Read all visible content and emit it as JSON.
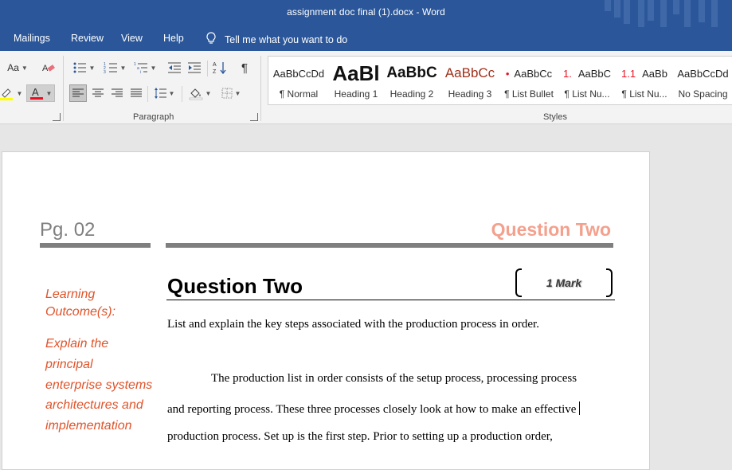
{
  "window": {
    "title": "assignment doc final (1).docx  -  Word"
  },
  "menu": {
    "tabs": [
      "Mailings",
      "Review",
      "View",
      "Help"
    ],
    "tell_me": "Tell me what you want to do"
  },
  "ribbon": {
    "font_group": {
      "change_case_label": "Aa"
    },
    "paragraph_group_label": "Paragraph",
    "styles_group_label": "Styles",
    "styles": [
      {
        "preview": "AaBbCcDd",
        "name": "¶ Normal"
      },
      {
        "preview": "AaBl",
        "name": "Heading 1"
      },
      {
        "preview": "AaBbC",
        "name": "Heading 2"
      },
      {
        "preview": "AaBbCc",
        "name": "Heading 3"
      },
      {
        "preview": "AaBbCc",
        "bullet": "•",
        "name": "¶ List Bullet"
      },
      {
        "preview": "AaBbC",
        "bullet": "1.",
        "name": "¶ List Nu..."
      },
      {
        "preview": "AaBb",
        "bullet": "1.1",
        "name": "¶ List Nu..."
      },
      {
        "preview": "AaBbCcDd",
        "name": "No Spacing"
      }
    ],
    "colors": {
      "highlight": "#ffff00",
      "font_color": "#e81123",
      "heading3": "#a0301a",
      "list_accent": "#e81123"
    }
  },
  "document": {
    "page_number": "Pg. 02",
    "header_title": "Question Two",
    "sidebar": {
      "title": "Learning Outcome(s):",
      "text": "Explain the principal enterprise systems architectures and implementation"
    },
    "question_title": "Question Two",
    "mark": "1 Mark",
    "prompt": "List and explain the key steps associated with the production process in order.",
    "answer_lines": [
      "The production list in order consists of the setup process, processing process",
      "and reporting process. These three processes closely look at how to make an effective",
      "production process. Set up is the first step. Prior to setting up a production order,"
    ]
  }
}
